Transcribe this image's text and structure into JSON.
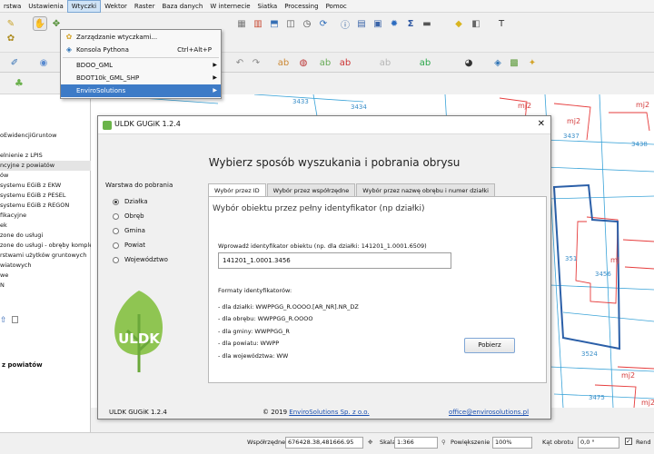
{
  "menubar": [
    "rstwa",
    "Ustawienia",
    "Wtyczki",
    "Wektor",
    "Raster",
    "Baza danych",
    "W internecie",
    "Siatka",
    "Processing",
    "Pomoc"
  ],
  "plugins_menu": {
    "items": [
      {
        "label": "Zarządzanie wtyczkami...",
        "shortcut": "",
        "has_submenu": false
      },
      {
        "label": "Konsola Pythona",
        "shortcut": "Ctrl+Alt+P",
        "has_submenu": false
      },
      {
        "label": "BDOO_GML",
        "shortcut": "",
        "has_submenu": true
      },
      {
        "label": "BDOT10k_GML_SHP",
        "shortcut": "",
        "has_submenu": true
      },
      {
        "label": "EnviroSolutions",
        "shortcut": "",
        "has_submenu": true
      }
    ]
  },
  "left_panel": {
    "tree": [
      "oEwidencjiGruntow",
      "",
      "elnienie z LPIS",
      "ncyjne z powiatów",
      "ów",
      "systemu EGiB z EKW",
      "systemu EGiB z PESEL",
      "systemu EGiB z REGON",
      "fikacyjne",
      "ek",
      "zone do usługi",
      "zone do usługi - obręby komple",
      "rstwami użytków gruntowych",
      "wiatowych",
      "we",
      "N"
    ],
    "footer": "z powiatów"
  },
  "map_labels": [
    "3433",
    "3434",
    "mj2",
    "mj2",
    "3437",
    "3438",
    "mj2",
    "mj",
    "3456",
    "351",
    "3524",
    "3475",
    "mj2",
    "mj2"
  ],
  "dialog": {
    "title": "ULDK GUGiK 1.2.4",
    "heading": "Wybierz sposób wyszukania i pobrania obrysu",
    "group_title": "Warstwa do pobrania",
    "options": [
      "Działka",
      "Obręb",
      "Gmina",
      "Powiat",
      "Województwo"
    ],
    "selected_option": "Działka",
    "logo_text": "ULDK",
    "tabs": [
      "Wybór przez ID",
      "Wybór przez współrzędne",
      "Wybór przez nazwę obrębu i numer działki"
    ],
    "tab_title": "Wybór obiektu przez pełny identyfikator (np działki)",
    "input_label": "Wprowadź identyfikator obiektu (np. dla działki: 141201_1.0001.6509)",
    "input_value": "141201_1.0001.3456",
    "formats_title": "Formaty identyfikatorów:",
    "formats": [
      "- dla działki: WWPPGG_R.OOOO.[AR_NR].NR_DZ",
      "- dla obrębu: WWPPGG_R.OOOO",
      "- dla gminy: WWPPGG_R",
      "- dla powiatu: WWPP",
      "- dla województwa: WW"
    ],
    "button": "Pobierz",
    "footer_version": "ULDK GUGiK 1.2.4",
    "footer_copy_prefix": "© 2019 ",
    "footer_copy_link": "EnviroSolutions Sp. z o.o.",
    "footer_email": "office@envirosolutions.pl"
  },
  "statusbar": {
    "coords_label": "Współrzędne",
    "coords_value": "676428.38,481666.95",
    "scale_label": "Skala",
    "scale_value": "1:366",
    "zoom_label": "Powiększenie",
    "zoom_value": "100%",
    "rotation_label": "Kąt obrotu",
    "rotation_value": "0,0 °",
    "render_label": "Rend"
  }
}
